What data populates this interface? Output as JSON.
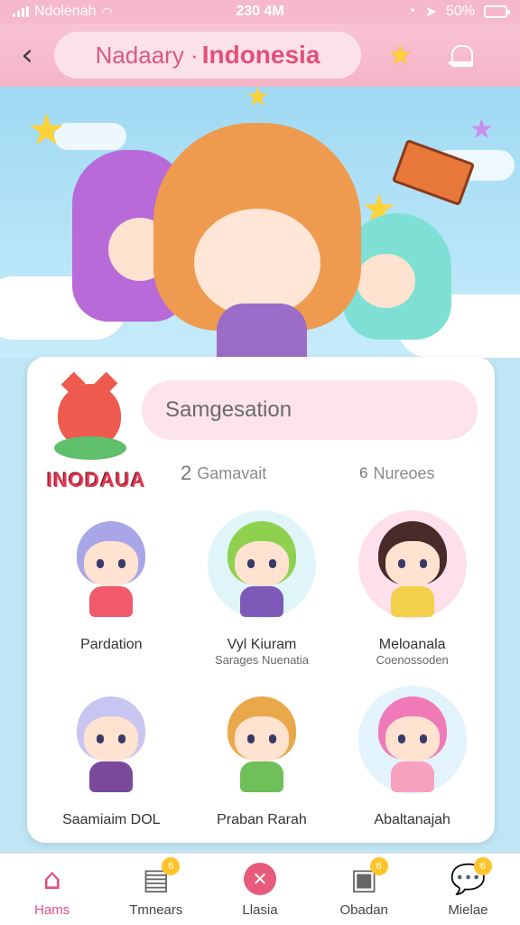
{
  "status_bar": {
    "carrier": "Ndolenah",
    "time": "230 4M",
    "battery": "50%"
  },
  "header": {
    "title_prefix": "Nadaary ·",
    "title_main": "Indonesia",
    "back_glyph": "‹"
  },
  "card": {
    "logo_text": "INODAUA",
    "search_placeholder": "Samgesation",
    "chip_left_num": "2",
    "chip_left_label": "Gamavait",
    "chip_right_num": "6",
    "chip_right_label": "Nureoes",
    "tiles": [
      {
        "label": "Pardation",
        "sub": "",
        "hair": "#a8a6e6",
        "shirt": "#f05a6a",
        "bg": "#ffffff"
      },
      {
        "label": "Vyl Kiuram",
        "sub": "Sarages Nuenatia",
        "hair": "#8fd14f",
        "shirt": "#7d5ab8",
        "bg": "#dff5f9"
      },
      {
        "label": "Meloanala",
        "sub": "Coenossoden",
        "hair": "#4a2a28",
        "shirt": "#f3d04a",
        "bg": "#fde0ec"
      },
      {
        "label": "Saamiaim DOL",
        "sub": "",
        "hair": "#c8c6f0",
        "shirt": "#7a4a9a",
        "bg": "#ffffff"
      },
      {
        "label": "Praban Rarah",
        "sub": "",
        "hair": "#e9a94a",
        "shirt": "#6fbf5a",
        "bg": "#ffffff"
      },
      {
        "label": "Abaltanajah",
        "sub": "",
        "hair": "#f07ab8",
        "shirt": "#f7a0c0",
        "bg": "#e3f3fb"
      }
    ]
  },
  "bottom_nav": [
    {
      "label": "Hams",
      "icon": "home-icon",
      "active": true,
      "badge": ""
    },
    {
      "label": "Tmnears",
      "icon": "document-icon",
      "active": false,
      "badge": "6"
    },
    {
      "label": "Llasia",
      "icon": "close-circle-icon",
      "active": false,
      "badge": ""
    },
    {
      "label": "Obadan",
      "icon": "folder-icon",
      "active": false,
      "badge": "6"
    },
    {
      "label": "Mielae",
      "icon": "chat-icon",
      "active": false,
      "badge": "6"
    }
  ],
  "colors": {
    "accent": "#e0517c",
    "header_bg": "#f6b4c8",
    "sky": "#9fd9f3"
  }
}
